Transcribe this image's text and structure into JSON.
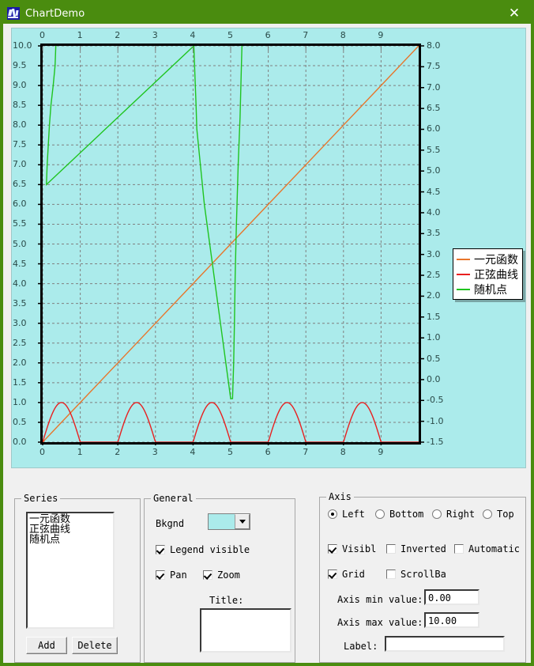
{
  "window": {
    "title": "ChartDemo",
    "icon": "app-icon",
    "close_label": "✕"
  },
  "colors": {
    "titlebar": "#4a8c0f",
    "chart_background": "#abebeb",
    "dialog_background": "#f0f0f0",
    "series_linear": "#e8752a",
    "series_sine": "#e81f1f",
    "series_random": "#1fc41f",
    "grid": "#808080"
  },
  "chart_data": {
    "type": "line",
    "title": "",
    "xlabel": "",
    "ylabel": "",
    "grid": true,
    "legend_position": "right",
    "axes": {
      "bottom": {
        "label": "",
        "ticks": [
          "0",
          "1",
          "2",
          "3",
          "4",
          "5",
          "6",
          "7",
          "8",
          "9"
        ],
        "min": 0,
        "max": 10
      },
      "top": {
        "label": "",
        "ticks": [
          "0",
          "1",
          "2",
          "3",
          "4",
          "5",
          "6",
          "7",
          "8",
          "9"
        ],
        "min": 0,
        "max": 10
      },
      "left": {
        "label": "",
        "min": 0.0,
        "max": 10.0,
        "step": 0.5,
        "ticks": [
          "10.0",
          "9.5",
          "9.0",
          "8.5",
          "8.0",
          "7.5",
          "7.0",
          "6.5",
          "6.0",
          "5.5",
          "5.0",
          "4.5",
          "4.0",
          "3.5",
          "3.0",
          "2.5",
          "2.0",
          "1.5",
          "1.0",
          "0.5",
          "0.0"
        ]
      },
      "right": {
        "label": "",
        "min": -1.5,
        "max": 8.0,
        "step": 0.5,
        "ticks": [
          "8.0",
          "7.5",
          "7.0",
          "6.5",
          "6.0",
          "5.5",
          "5.0",
          "4.5",
          "4.0",
          "3.5",
          "3.0",
          "2.5",
          "2.0",
          "1.5",
          "1.0",
          "0.5",
          "0.0",
          "-0.5",
          "-1.0",
          "-1.5"
        ]
      }
    },
    "series": [
      {
        "name": "一元函数",
        "color": "#e8752a",
        "axis": "left",
        "description": "linear y = x",
        "x": [
          0,
          1,
          2,
          3,
          4,
          5,
          6,
          7,
          8,
          9,
          10
        ],
        "values": [
          0,
          1,
          2,
          3,
          4,
          5,
          6,
          7,
          8,
          9,
          10
        ]
      },
      {
        "name": "正弦曲线",
        "color": "#e81f1f",
        "axis": "left",
        "description": "rectified sine |sin(pi*x)| amplitude 1.0, period 2",
        "x": [
          0,
          0.5,
          1,
          1.5,
          2,
          2.5,
          3,
          3.5,
          4,
          4.5,
          5,
          5.5,
          6,
          6.5,
          7,
          7.5,
          8,
          8.5,
          9,
          9.5,
          10
        ],
        "values": [
          0,
          1,
          0,
          0,
          0,
          1,
          0,
          0,
          0,
          1,
          0,
          0,
          0,
          1,
          0,
          0,
          0,
          1,
          0,
          0,
          0
        ]
      },
      {
        "name": "随机点",
        "color": "#1fc41f",
        "axis": "left",
        "description": "random points polyline",
        "x": [
          0.35,
          0.33,
          0.28,
          0.22,
          0.18,
          0.15,
          0.12,
          0.1,
          4.02,
          4.04,
          4.06,
          4.08,
          4.1,
          4.3,
          4.7,
          5.0,
          5.05,
          5.08,
          5.1,
          5.12,
          5.15,
          5.2,
          5.25,
          5.28,
          5.3
        ],
        "values": [
          10.0,
          9.5,
          9.0,
          8.5,
          8.0,
          7.5,
          7.0,
          6.5,
          10.0,
          9.5,
          9.0,
          8.5,
          7.9,
          6.0,
          3.2,
          1.1,
          1.1,
          2.0,
          3.0,
          4.2,
          5.4,
          7.0,
          8.2,
          9.3,
          10.0
        ]
      }
    ]
  },
  "series_panel": {
    "title": "Series",
    "items": [
      "一元函数",
      "正弦曲线",
      "随机点"
    ],
    "add_label": "Add",
    "delete_label": "Delete"
  },
  "general_panel": {
    "title": "General",
    "bkgnd_label": "Bkgnd",
    "bkgnd_color": "#abebeb",
    "legend_visible_label": "Legend visible",
    "legend_visible_checked": true,
    "pan_label": "Pan",
    "pan_checked": true,
    "zoom_label": "Zoom",
    "zoom_checked": true,
    "title_label": "Title:",
    "title_value": ""
  },
  "axis_panel": {
    "title": "Axis",
    "radios": [
      {
        "label": "Left",
        "selected": true
      },
      {
        "label": "Bottom",
        "selected": false
      },
      {
        "label": "Right",
        "selected": false
      },
      {
        "label": "Top",
        "selected": false
      }
    ],
    "checks": [
      {
        "label": "Visibl",
        "checked": true
      },
      {
        "label": "Inverted",
        "checked": false
      },
      {
        "label": "Automatic",
        "checked": false
      },
      {
        "label": "Grid",
        "checked": true
      },
      {
        "label": "ScrollBa",
        "checked": false
      }
    ],
    "min_label": "Axis min value:",
    "min_value": "0.00",
    "max_label": "Axis max value:",
    "max_value": "10.00",
    "label_label": "Label:",
    "label_value": ""
  }
}
